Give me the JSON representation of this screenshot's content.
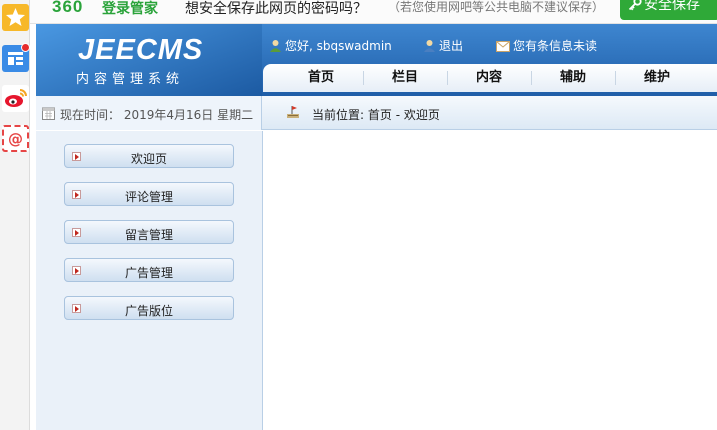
{
  "dock": {
    "items": [
      "favorites-star",
      "app-list",
      "weibo",
      "mail"
    ]
  },
  "password_bar": {
    "logo": "360",
    "logo_sub": "登录管家",
    "question": "想安全保存此网页的密码吗？",
    "hint": "（若您使用网吧等公共电脑不建议保存）",
    "save_button": "安全保存"
  },
  "header": {
    "logo_title": "JEECMS",
    "logo_subtitle": "内容管理系统",
    "greeting": "您好, sbqswadmin",
    "logout": "退出",
    "messages": "您有条信息未读"
  },
  "nav": {
    "tabs": [
      "首页",
      "栏目",
      "内容",
      "辅助",
      "维护"
    ]
  },
  "subbar": {
    "time_label": "现在时间：",
    "time_value": "2019年4月16日 星期二",
    "location_label": "当前位置:",
    "location_value": "首页 - 欢迎页"
  },
  "sidebar": {
    "items": [
      "欢迎页",
      "评论管理",
      "留言管理",
      "广告管理",
      "广告版位"
    ]
  },
  "colors": {
    "header_blue": "#1f5ea8",
    "save_green": "#2fa938",
    "logo_green": "#2aa33a"
  }
}
